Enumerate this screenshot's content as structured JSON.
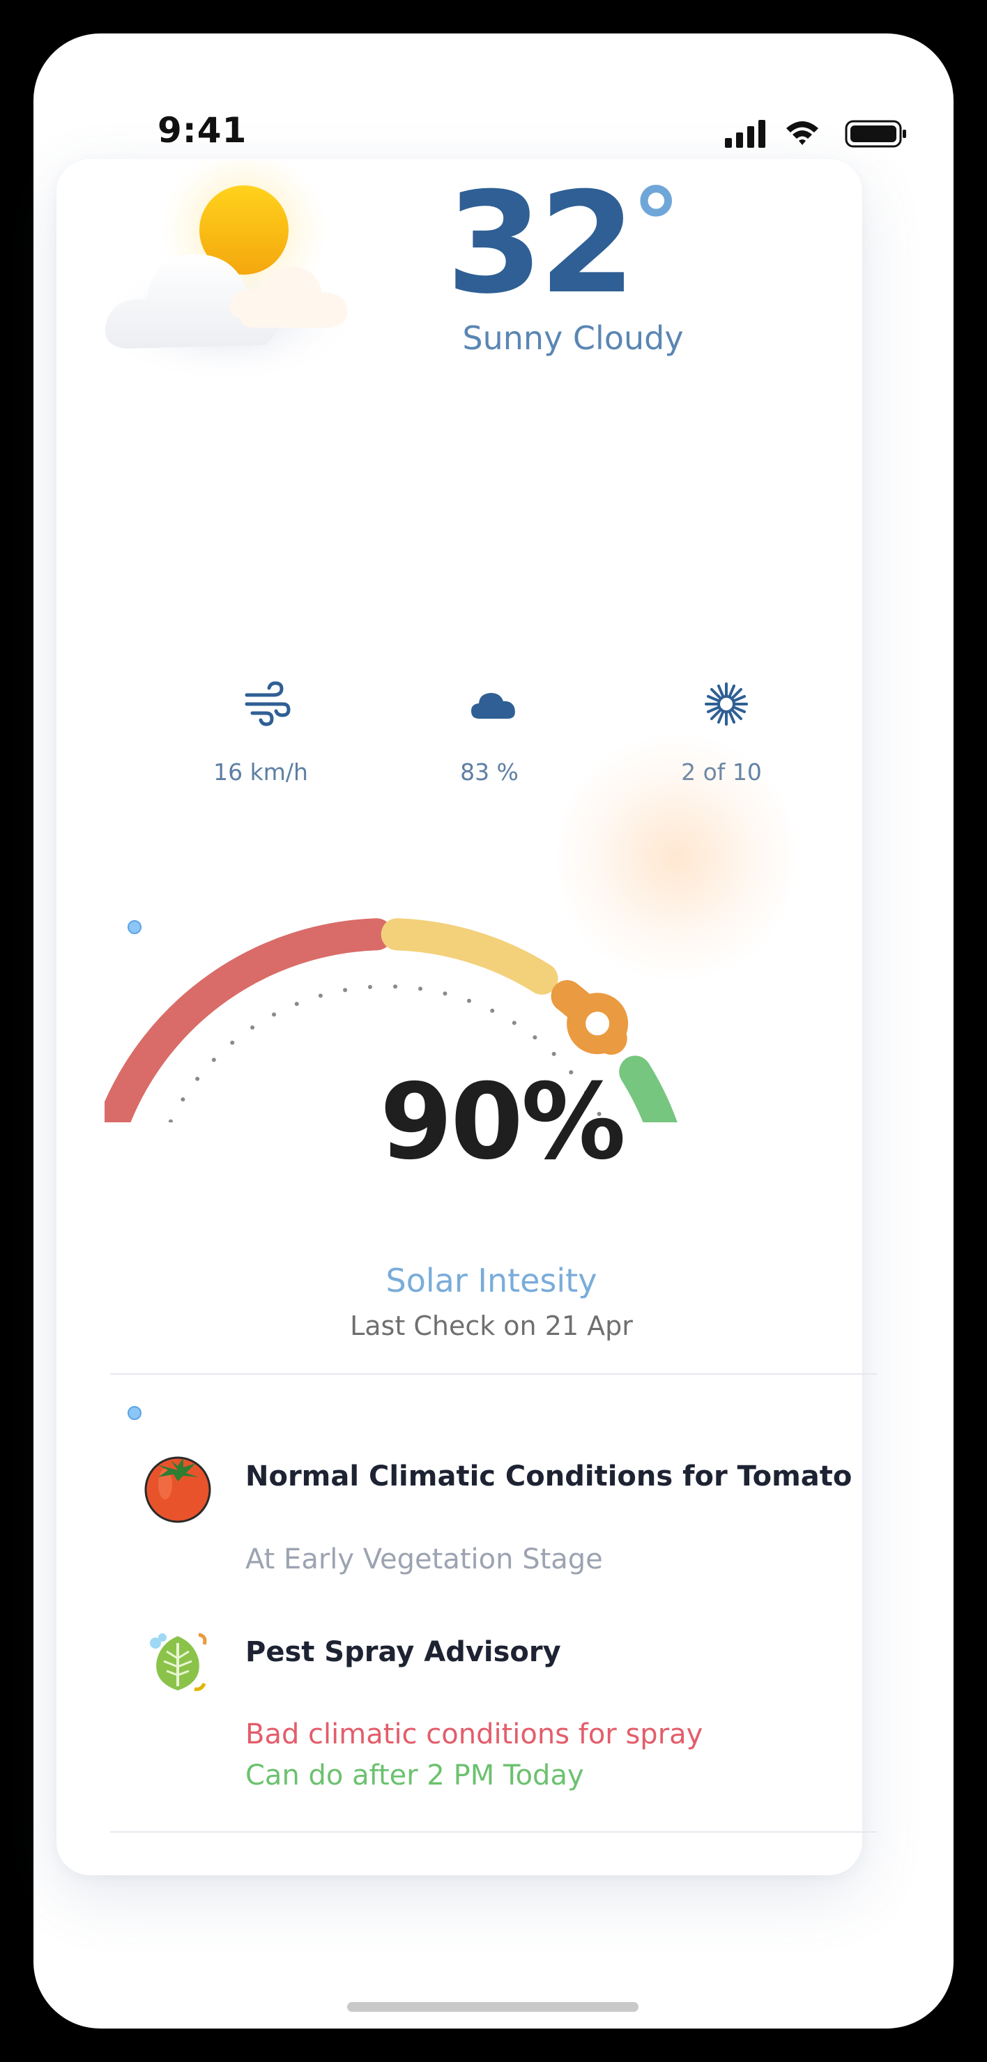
{
  "status_bar": {
    "time": "9:41"
  },
  "weather": {
    "temperature": "32",
    "degree_symbol": "°",
    "condition": "Sunny Cloudy",
    "icon": "sun-behind-cloud-icon"
  },
  "stats": [
    {
      "icon": "wind-icon",
      "label": "16 km/h"
    },
    {
      "icon": "cloud-icon",
      "label": "83 %"
    },
    {
      "icon": "sun-uv-icon",
      "label": "2 of 10"
    }
  ],
  "solar": {
    "percent_label": "90%",
    "level_fraction": 0.9,
    "title": "Solar Intesity",
    "last_check": "Last Check on 21 Apr",
    "segment_colors": [
      "#d96c68",
      "#f3d07a",
      "#ea9a40",
      "#77c67f"
    ]
  },
  "advisories": [
    {
      "icon": "tomato-icon",
      "title": "Normal Climatic Conditions for Tomato",
      "lines": [
        {
          "text": "At Early Vegetation Stage",
          "color": "#9ca3b1"
        }
      ]
    },
    {
      "icon": "leaf-spray-icon",
      "title": "Pest Spray Advisory",
      "lines": [
        {
          "text": "Bad climatic conditions for spray",
          "color": "#e35d6a"
        },
        {
          "text": "Can do after 2 PM Today",
          "color": "#6cc16f"
        }
      ]
    }
  ]
}
